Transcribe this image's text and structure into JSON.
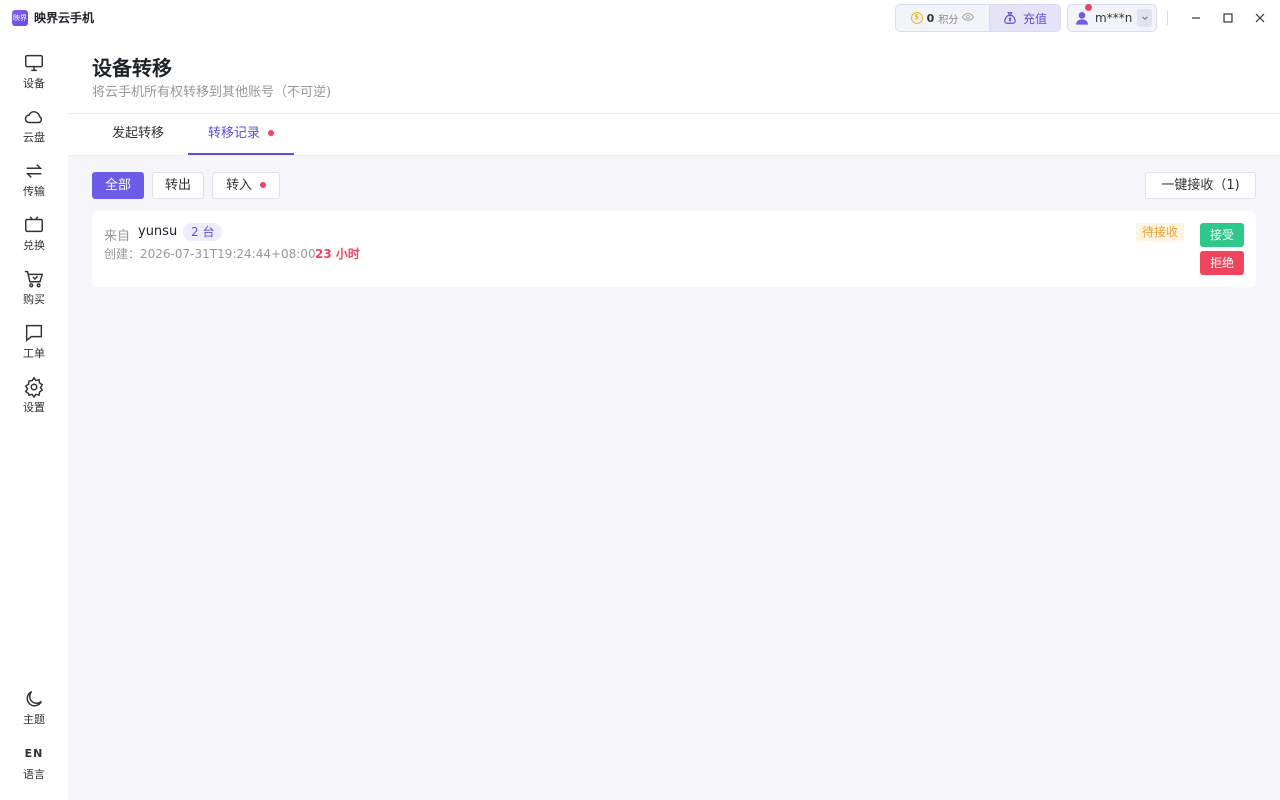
{
  "app": {
    "title": "映界云手机",
    "logo_text": "映界"
  },
  "titlebar": {
    "points_value": "0",
    "points_label": "积分",
    "recharge_label": "充值",
    "username": "m***n"
  },
  "sidebar": {
    "items": [
      {
        "label": "设备",
        "icon": "monitor-icon"
      },
      {
        "label": "云盘",
        "icon": "cloud-icon"
      },
      {
        "label": "传输",
        "icon": "transfer-icon"
      },
      {
        "label": "兑换",
        "icon": "ticket-icon"
      },
      {
        "label": "购买",
        "icon": "cart-icon"
      },
      {
        "label": "工单",
        "icon": "chat-icon"
      },
      {
        "label": "设置",
        "icon": "gear-icon"
      }
    ],
    "bottom": [
      {
        "label": "主题",
        "icon": "moon-icon"
      },
      {
        "label": "语言",
        "glyph": "EN"
      }
    ]
  },
  "header": {
    "title": "设备转移",
    "subtitle": "将云手机所有权转移到其他账号（不可逆)"
  },
  "tabs": [
    {
      "label": "发起转移",
      "active": false
    },
    {
      "label": "转移记录",
      "active": true,
      "dot": true
    }
  ],
  "filters": [
    {
      "label": "全部",
      "active": true
    },
    {
      "label": "转出",
      "active": false
    },
    {
      "label": "转入",
      "active": false,
      "dot": true
    }
  ],
  "accept_all_label": "一键接收（1)",
  "records": [
    {
      "from_label": "来自",
      "from_user": "yunsu",
      "count": "2 台",
      "created": "创建：2026-07-31T19:24:44+08:00",
      "remaining": "23 小时",
      "status": "待接收",
      "accept_label": "接受",
      "reject_label": "拒绝"
    }
  ],
  "colors": {
    "accent": "#5b4fe0",
    "accept": "#2ec98a",
    "reject": "#f0445c",
    "pending": "#f0a030"
  }
}
